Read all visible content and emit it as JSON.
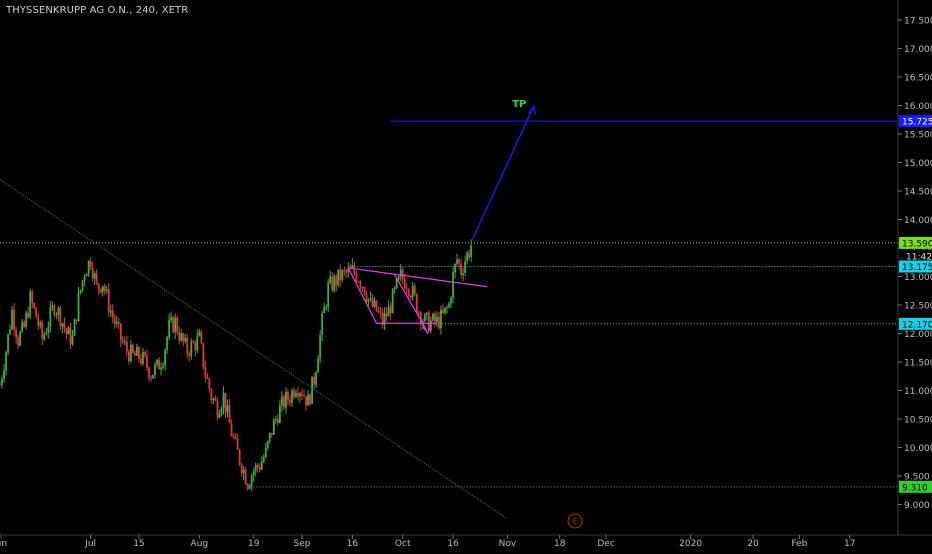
{
  "header": {
    "title": "THYSSENKRUPP AG O.N., 240, XETR"
  },
  "colors": {
    "background": "#000000",
    "up_candle": "#3cb043",
    "down_candle": "#e03a3a",
    "trendline": "#22aa22",
    "magenta": "#e040e0",
    "tp_line": "#1a1aff",
    "tp_text": "#33dd33",
    "resistance_line": "#c8d400",
    "current_tag": "#7ddc1f",
    "cyan_tag": "#18d0e6",
    "support_tag": "#18d0e6",
    "low_tag": "#33cc33",
    "event_circle": "#c0302a"
  },
  "chart_data": {
    "type": "candlestick",
    "title": "THYSSENKRUPP AG O.N., 240, XETR",
    "ylim": [
      8.75,
      17.75
    ],
    "y_ticks": [
      "17.500",
      "17.000",
      "16.500",
      "16.000",
      "15.500",
      "15.000",
      "14.500",
      "14.000",
      "13.500",
      "13.000",
      "12.500",
      "12.000",
      "11.500",
      "11.000",
      "10.500",
      "10.000",
      "9.500",
      "9.000"
    ],
    "x_ticks": [
      {
        "label": "Jun",
        "x": 0.0
      },
      {
        "label": "Jul",
        "x": 22.5
      },
      {
        "label": "15",
        "x": 34.5
      },
      {
        "label": "Aug",
        "x": 49.5
      },
      {
        "label": "19",
        "x": 63.0
      },
      {
        "label": "Sep",
        "x": 75.0
      },
      {
        "label": "16",
        "x": 87.5
      },
      {
        "label": "Oct",
        "x": 100.0
      },
      {
        "label": "16",
        "x": 112.5
      },
      {
        "label": "Nov",
        "x": 126.0
      },
      {
        "label": "18",
        "x": 139.0
      },
      {
        "label": "Dec",
        "x": 150.5
      },
      {
        "label": "2020",
        "x": 171.5
      },
      {
        "label": "20",
        "x": 187.0
      },
      {
        "label": "Feb",
        "x": 198.5
      },
      {
        "label": "17",
        "x": 211.0
      }
    ],
    "xlim": [
      0,
      222
    ],
    "candles_path": [
      [
        0,
        11.1
      ],
      [
        1.5,
        11.7
      ],
      [
        3,
        12.4
      ],
      [
        4.5,
        11.9
      ],
      [
        6,
        12.1
      ],
      [
        7.5,
        12.6
      ],
      [
        9,
        12.3
      ],
      [
        10.5,
        11.9
      ],
      [
        12,
        12.2
      ],
      [
        13.5,
        12.5
      ],
      [
        15,
        12.3
      ],
      [
        16.5,
        12.0
      ],
      [
        18,
        11.9
      ],
      [
        19.5,
        12.6
      ],
      [
        21,
        13.1
      ],
      [
        22.5,
        13.3
      ],
      [
        24,
        12.8
      ],
      [
        25.5,
        12.9
      ],
      [
        27,
        12.5
      ],
      [
        28.5,
        12.2
      ],
      [
        30,
        11.9
      ],
      [
        31.5,
        11.7
      ],
      [
        33,
        11.6
      ],
      [
        34.5,
        11.6
      ],
      [
        36,
        11.5
      ],
      [
        37.5,
        11.3
      ],
      [
        39,
        11.4
      ],
      [
        40.5,
        11.6
      ],
      [
        42,
        12.1
      ],
      [
        43.5,
        12.2
      ],
      [
        45,
        11.9
      ],
      [
        46.5,
        11.7
      ],
      [
        48,
        11.8
      ],
      [
        49.5,
        11.9
      ],
      [
        51,
        11.3
      ],
      [
        52.5,
        10.9
      ],
      [
        54,
        10.7
      ],
      [
        55.5,
        10.9
      ],
      [
        57,
        10.4
      ],
      [
        58.5,
        10.0
      ],
      [
        60,
        9.7
      ],
      [
        61.5,
        9.4
      ],
      [
        63,
        9.6
      ],
      [
        64.5,
        9.7
      ],
      [
        66,
        9.9
      ],
      [
        67.5,
        10.3
      ],
      [
        69,
        10.6
      ],
      [
        70.5,
        10.8
      ],
      [
        72,
        10.9
      ],
      [
        73.5,
        11.1
      ],
      [
        75,
        11.0
      ],
      [
        76.5,
        10.8
      ],
      [
        78,
        11.2
      ],
      [
        79,
        11.7
      ],
      [
        80,
        12.2
      ],
      [
        81.5,
        12.8
      ],
      [
        83,
        12.9
      ],
      [
        84.5,
        13.0
      ],
      [
        86,
        13.05
      ],
      [
        87.5,
        13.1
      ],
      [
        89,
        13.0
      ],
      [
        90.5,
        12.8
      ],
      [
        92,
        12.5
      ],
      [
        93.5,
        12.4
      ],
      [
        95,
        12.2
      ],
      [
        96.5,
        12.4
      ],
      [
        98,
        12.7
      ],
      [
        99.5,
        13.0
      ],
      [
        101,
        12.9
      ],
      [
        102.5,
        12.7
      ],
      [
        104,
        12.4
      ],
      [
        105.5,
        12.2
      ],
      [
        107,
        12.2
      ],
      [
        108.5,
        12.2
      ],
      [
        110,
        12.3
      ],
      [
        111.5,
        12.5
      ],
      [
        112.5,
        13.0
      ],
      [
        113.5,
        13.3
      ],
      [
        114.5,
        13.1
      ],
      [
        115.5,
        13.3
      ],
      [
        116.5,
        13.45
      ],
      [
        117.2,
        13.59
      ]
    ],
    "levels": [
      {
        "name": "resistance",
        "value": 13.59,
        "tag": "13.590",
        "sub_tag": "11:42"
      },
      {
        "name": "cyan",
        "value": 13.175,
        "tag": "13.175"
      },
      {
        "name": "support",
        "value": 12.17,
        "tag": "12.170"
      },
      {
        "name": "low",
        "value": 9.31,
        "tag": "9.310"
      },
      {
        "name": "target",
        "value": 15.725,
        "tag": "15.725"
      }
    ],
    "annotations": {
      "tp_label": "TP",
      "event_label": "E"
    }
  }
}
